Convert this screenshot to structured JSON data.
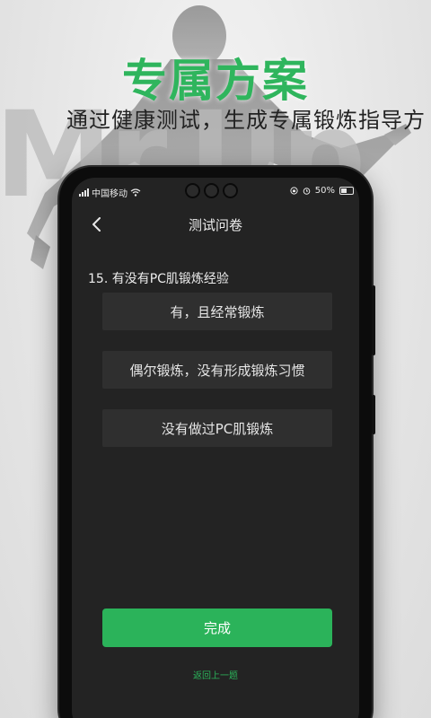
{
  "promo": {
    "headline": "专属方案",
    "subheadline": "通过健康测试，生成专属锻炼指导方",
    "brand_watermark": "Mr.Up",
    "accent_color": "#2fb55d"
  },
  "status_bar": {
    "carrier": "中国移动",
    "battery": "50%",
    "icons": [
      "signal-icon",
      "wifi-icon",
      "lock-rotation-icon",
      "alarm-icon",
      "battery-icon"
    ]
  },
  "nav": {
    "back_icon": "chevron-left-icon",
    "title": "测试问卷"
  },
  "question": {
    "text": "15. 有没有PC肌锻炼经验",
    "options": [
      {
        "label": "有，且经常锻炼"
      },
      {
        "label": "偶尔锻炼，没有形成锻炼习惯"
      },
      {
        "label": "没有做过PC肌锻炼"
      }
    ]
  },
  "actions": {
    "finish_label": "完成",
    "prev_label": "返回上一题",
    "primary_color": "#2bb35a"
  }
}
